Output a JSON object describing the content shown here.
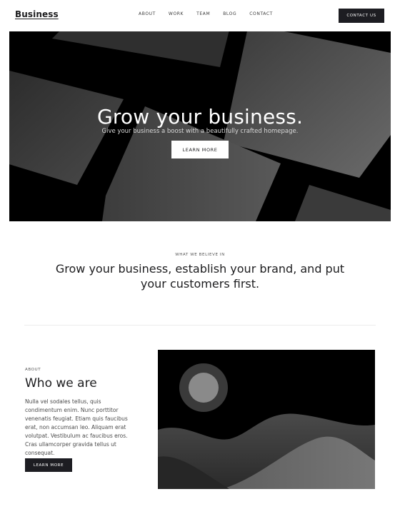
{
  "header": {
    "brand": "Business",
    "nav": [
      "ABOUT",
      "WORK",
      "TEAM",
      "BLOG",
      "CONTACT"
    ],
    "cta_label": "CONTACT US"
  },
  "hero": {
    "title": "Grow your business.",
    "subtitle": "Give your business a boost with a beautifully crafted homepage.",
    "button_label": "LEARN MORE"
  },
  "belief": {
    "eyebrow": "WHAT WE BELIEVE IN",
    "text": "Grow your business, establish your brand, and put your customers first."
  },
  "about": {
    "eyebrow": "ABOUT",
    "title": "Who we are",
    "body": "Nulla vel sodales tellus, quis condimentum enim. Nunc porttitor venenatis feugiat. Etiam quis faucibus erat, non accumsan leo. Aliquam erat volutpat. Vestibulum ac faucibus eros. Cras ullamcorper gravida tellus ut consequat.",
    "button_label": "LEARN MORE"
  },
  "colors": {
    "dark": "#1d1d22",
    "background": "#ffffff",
    "hero_background": "#000000"
  }
}
